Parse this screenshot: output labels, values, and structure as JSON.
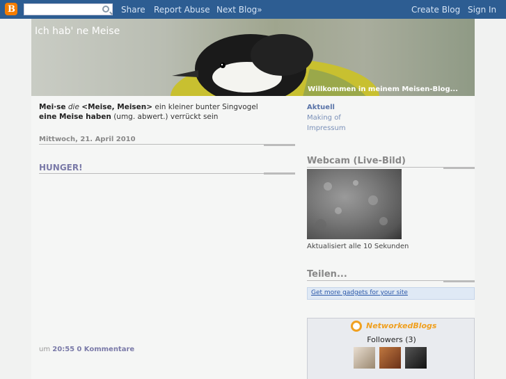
{
  "navbar": {
    "logo_letter": "B",
    "search": {
      "value": "",
      "placeholder": ""
    },
    "links": [
      "Share",
      "Report Abuse",
      "Next Blog»"
    ],
    "right_links": [
      "Create Blog",
      "Sign In"
    ],
    "color": "#2d5d92"
  },
  "header": {
    "title": "Ich hab' ne Meise",
    "description": "Willkommen in meinem Meisen-Blog..."
  },
  "main": {
    "intro_word": "Mei·se",
    "intro_article": "die",
    "intro_forms": "<Meise, Meisen>",
    "intro_def": "ein kleiner bunter Singvogel",
    "intro_phrase": "eine Meise haben",
    "intro_usage": "(umg. abwert.)",
    "intro_phrase_def": "verrückt sein",
    "date": "Mittwoch, 21. April 2010",
    "post_title": "HUNGER!",
    "footer_prefix": "um",
    "footer_time": "20:55",
    "footer_comments": "0 Kommentare"
  },
  "sidebar": {
    "pages": [
      "Aktuell",
      "Making of",
      "Impressum"
    ],
    "webcam_title": "Webcam (Live-Bild)",
    "webcam_note": "Aktualisiert alle 10 Sekunden",
    "share_title": "Teilen...",
    "gadget_link": "Get more gadgets for your site",
    "networkedblogs_logo": "NetworkedBlogs",
    "followers": "Followers (3)"
  }
}
